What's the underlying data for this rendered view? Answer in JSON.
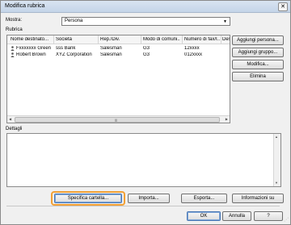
{
  "window": {
    "title": "Modifica rubrica",
    "close_glyph": "✕"
  },
  "filter": {
    "label": "Mostra:",
    "value": "Persona",
    "options": [
      "Persona"
    ]
  },
  "section_rubrica": "Rubrica",
  "table": {
    "columns": [
      "Nome destinato...",
      "Società",
      "Rep./Div.",
      "Modo di comuni...",
      "Numero di fax/I...",
      "Desti"
    ],
    "rows": [
      [
        "Fxxxxxxx Green",
        "sss Bank",
        "Salesman",
        "G3",
        "12xxxx"
      ],
      [
        "Robert Brown",
        "XYZ Corporation",
        "Salesman",
        "G3",
        "012xxxx"
      ]
    ],
    "row_icon": "person-icon"
  },
  "side_buttons": {
    "add_person": "Aggiungi persona...",
    "add_group": "Aggiungi gruppo...",
    "modify": "Modifica...",
    "delete": "Elimina"
  },
  "details_label": "Dettagli",
  "bottom_buttons": {
    "specify_folder": "Specifica cartella...",
    "import": "Importa...",
    "export": "Esporta...",
    "info": "Informazioni su"
  },
  "dialog_buttons": {
    "ok": "OK",
    "cancel": "Annulla",
    "help": "?"
  },
  "colors": {
    "highlight_ring": "#f2a035",
    "titlebar": "#c4d4e8"
  }
}
